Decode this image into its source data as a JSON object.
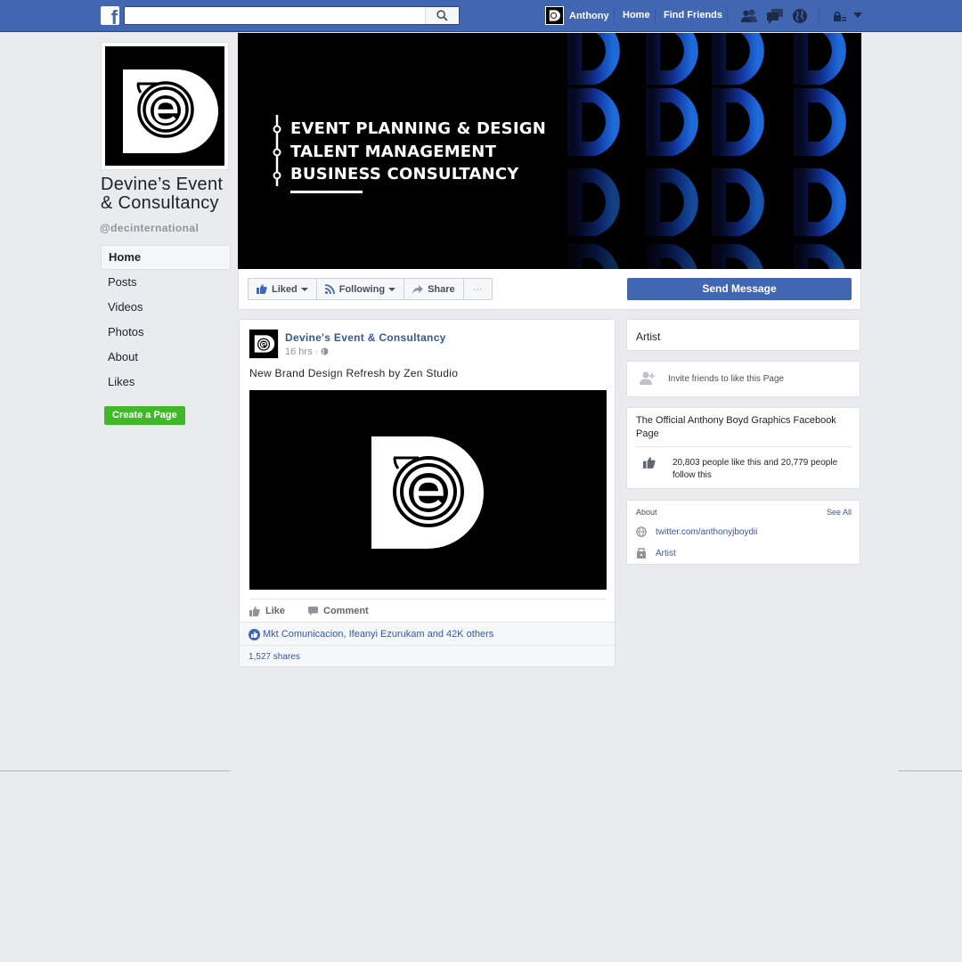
{
  "topbar": {
    "search_placeholder": "",
    "user_name": "Anthony",
    "nav_home": "Home",
    "nav_find_friends": "Find Friends"
  },
  "page": {
    "name": "Devine’s Event & Consultancy",
    "handle": "@decinternational",
    "nav": [
      "Home",
      "Posts",
      "Videos",
      "Photos",
      "About",
      "Likes"
    ],
    "create_page": "Create a Page"
  },
  "cover": {
    "lines": [
      "EVENT PLANNING & DESIGN",
      "TALENT MANAGEMENT",
      "BUSINESS CONSULTANCY"
    ]
  },
  "actions": {
    "liked": "Liked",
    "following": "Following",
    "share": "Share",
    "more": "···",
    "send_message": "Send Message"
  },
  "post": {
    "author": "Devine's Event & Consultancy",
    "time": "16 hrs",
    "text": "New Brand Design Refresh by Zen Studio",
    "like": "Like",
    "comment": "Comment",
    "likes_summary": "Mkt Comunicacion, Ifeanyi Ezurukam and 42K others",
    "shares": "1,527 shares"
  },
  "sidebar": {
    "category": "Artist",
    "invite": "Invite friends to like this Page",
    "description": "The Official Anthony Boyd Graphics Facebook Page",
    "likes_follows": "20,803 people like this and 20,779 people follow this",
    "about_header": "About",
    "see_all": "See All",
    "website": "twitter.com/anthonyjboydii",
    "category_link": "Artist"
  },
  "colors": {
    "brand_blue": "#4267b2",
    "link_blue": "#365899",
    "create_green": "#42b72a",
    "background": "#e9ebee"
  }
}
